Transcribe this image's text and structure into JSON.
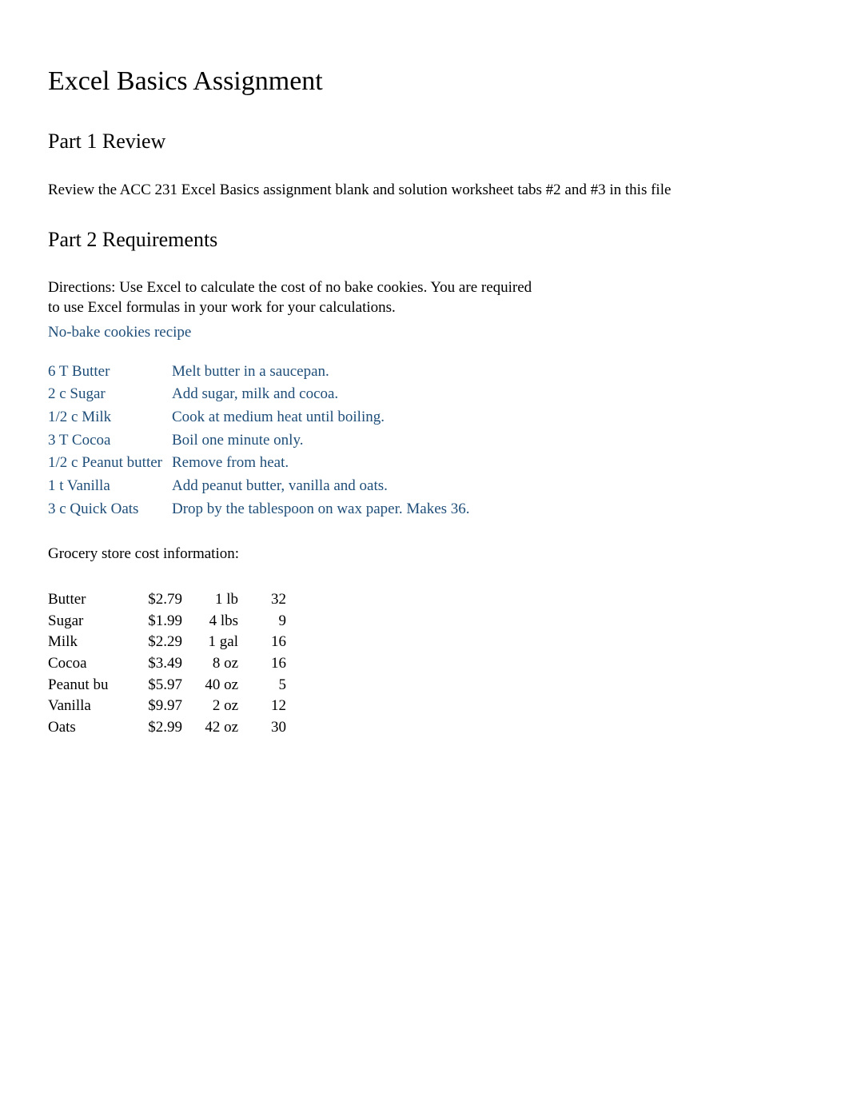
{
  "title": "Excel Basics Assignment",
  "part1": {
    "heading": "Part 1 Review",
    "text": "Review the ACC 231 Excel Basics assignment blank and solution worksheet tabs #2 and #3 in this file"
  },
  "part2": {
    "heading": "Part 2 Requirements",
    "directions_label": "Directions:",
    "directions_text": "Use Excel to calculate the cost of no bake cookies.  You are required to use Excel formulas in your work for your calculations.",
    "recipe_title": "No-bake cookies recipe",
    "recipe": [
      {
        "ingredient": "6 T Butter",
        "step": "Melt butter in a saucepan."
      },
      {
        "ingredient": "2 c Sugar",
        "step": "Add sugar, milk and cocoa."
      },
      {
        "ingredient": "1/2 c Milk",
        "step": "Cook at medium heat until boiling."
      },
      {
        "ingredient": "3 T Cocoa",
        "step": "Boil one minute only."
      },
      {
        "ingredient": "1/2 c Peanut butter",
        "step": "Remove from heat."
      },
      {
        "ingredient": "1 t Vanilla",
        "step": "Add peanut butter, vanilla and oats."
      },
      {
        "ingredient": "3 c Quick Oats",
        "step": "Drop by the tablespoon on wax paper. Makes 36."
      }
    ],
    "grocery_title": "Grocery store cost information:",
    "grocery": [
      {
        "name": "Butter",
        "price": "$2.79",
        "size": "1 lb",
        "qty": "32"
      },
      {
        "name": "Sugar",
        "price": "$1.99",
        "size": "4 lbs",
        "qty": "9"
      },
      {
        "name": "Milk",
        "price": "$2.29",
        "size": "1 gal",
        "qty": "16"
      },
      {
        "name": "Cocoa",
        "price": "$3.49",
        "size": "8 oz",
        "qty": "16"
      },
      {
        "name": "Peanut bu",
        "price": "$5.97",
        "size": "40 oz",
        "qty": "5"
      },
      {
        "name": "Vanilla",
        "price": "$9.97",
        "size": "2 oz",
        "qty": "12"
      },
      {
        "name": "Oats",
        "price": "$2.99",
        "size": "42 oz",
        "qty": "30"
      }
    ]
  }
}
